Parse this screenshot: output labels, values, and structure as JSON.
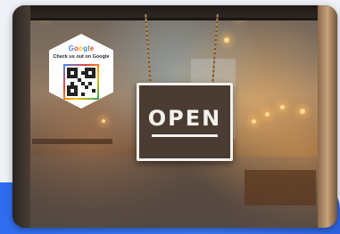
{
  "sign": {
    "text": "OPEN"
  },
  "sticker": {
    "logo_letters": [
      "G",
      "o",
      "o",
      "g",
      "l",
      "e"
    ],
    "caption": "Check us out on Google",
    "qr_icon": "qr-code-icon"
  },
  "colors": {
    "brand_blue": "#4285f4",
    "brand_red": "#ea4335",
    "brand_yellow": "#fbbc05",
    "brand_green": "#34a853",
    "accent_band": "#2f6df0",
    "sign_bg": "#4a3b33"
  }
}
